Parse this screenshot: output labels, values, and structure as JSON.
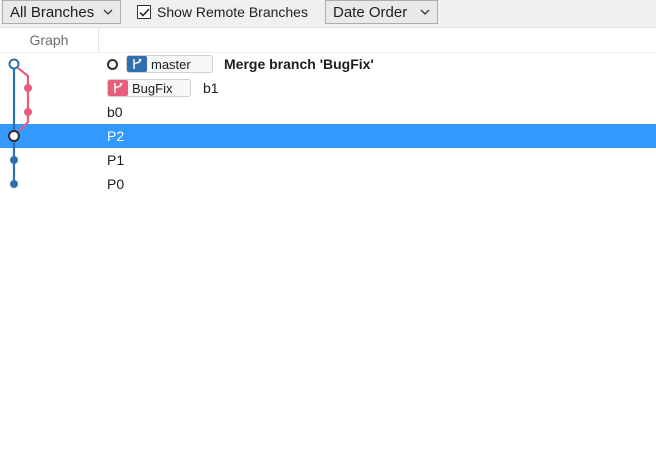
{
  "toolbar": {
    "branches_filter": {
      "label": "All Branches"
    },
    "show_remote": {
      "label": "Show Remote Branches",
      "checked": true
    },
    "order": {
      "label": "Date Order"
    }
  },
  "header": {
    "graph": "Graph"
  },
  "commits": [
    {
      "message": "Merge branch 'BugFix'",
      "branch": "master",
      "branch_color": "#2f6fad",
      "is_head": true
    },
    {
      "message": "b1",
      "branch": "BugFix",
      "branch_color": "#e85d7a"
    },
    {
      "message": "b0"
    },
    {
      "message": "P2",
      "selected": true
    },
    {
      "message": "P1"
    },
    {
      "message": "P0"
    }
  ],
  "colors": {
    "master_lane": "#2f6fad",
    "bugfix_lane": "#e85d7a",
    "selection": "#3399ff"
  }
}
